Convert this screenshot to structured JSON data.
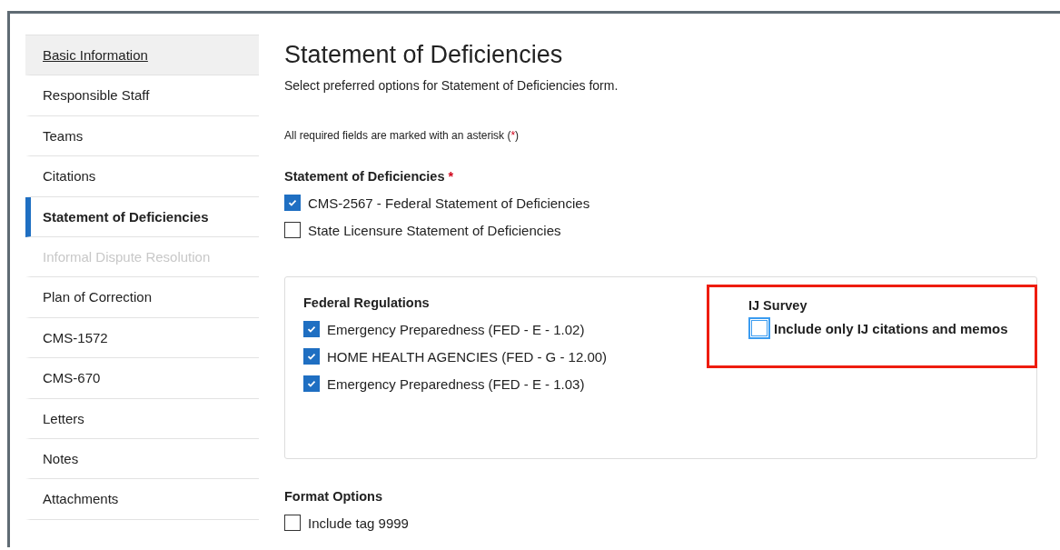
{
  "sidebar": {
    "items": [
      {
        "label": "Basic Information",
        "selected": false,
        "disabled": false,
        "hovered": true
      },
      {
        "label": "Responsible Staff",
        "selected": false,
        "disabled": false,
        "hovered": false
      },
      {
        "label": "Teams",
        "selected": false,
        "disabled": false,
        "hovered": false
      },
      {
        "label": "Citations",
        "selected": false,
        "disabled": false,
        "hovered": false
      },
      {
        "label": "Statement of Deficiencies",
        "selected": true,
        "disabled": false,
        "hovered": false
      },
      {
        "label": "Informal Dispute Resolution",
        "selected": false,
        "disabled": true,
        "hovered": false
      },
      {
        "label": "Plan of Correction",
        "selected": false,
        "disabled": false,
        "hovered": false
      },
      {
        "label": "CMS-1572",
        "selected": false,
        "disabled": false,
        "hovered": false
      },
      {
        "label": "CMS-670",
        "selected": false,
        "disabled": false,
        "hovered": false
      },
      {
        "label": "Letters",
        "selected": false,
        "disabled": false,
        "hovered": false
      },
      {
        "label": "Notes",
        "selected": false,
        "disabled": false,
        "hovered": false
      },
      {
        "label": "Attachments",
        "selected": false,
        "disabled": false,
        "hovered": false
      }
    ]
  },
  "page": {
    "title": "Statement of Deficiencies",
    "subtitle": "Select preferred options for Statement of Deficiencies form.",
    "required_note": {
      "before": "All required fields are marked with an asterisk (",
      "mark": "*",
      "after": ")"
    }
  },
  "statement_section": {
    "heading": "Statement of Deficiencies",
    "required_mark": "*",
    "options": [
      {
        "label": "CMS-2567 - Federal Statement of Deficiencies",
        "checked": true
      },
      {
        "label": "State Licensure Statement of Deficiencies",
        "checked": false
      }
    ]
  },
  "federal_regulations": {
    "heading": "Federal Regulations",
    "options": [
      {
        "label": "Emergency Preparedness (FED - E - 1.02)",
        "checked": true
      },
      {
        "label": "HOME HEALTH AGENCIES (FED - G - 12.00)",
        "checked": true
      },
      {
        "label": "Emergency Preparedness (FED - E - 1.03)",
        "checked": true
      }
    ]
  },
  "ij_survey": {
    "heading": "IJ Survey",
    "highlighted": true,
    "option": {
      "label": "Include only IJ citations and memos",
      "checked": false,
      "focused": true
    }
  },
  "format_options": {
    "heading": "Format Options",
    "options": [
      {
        "label": "Include tag 9999",
        "checked": false
      }
    ]
  }
}
